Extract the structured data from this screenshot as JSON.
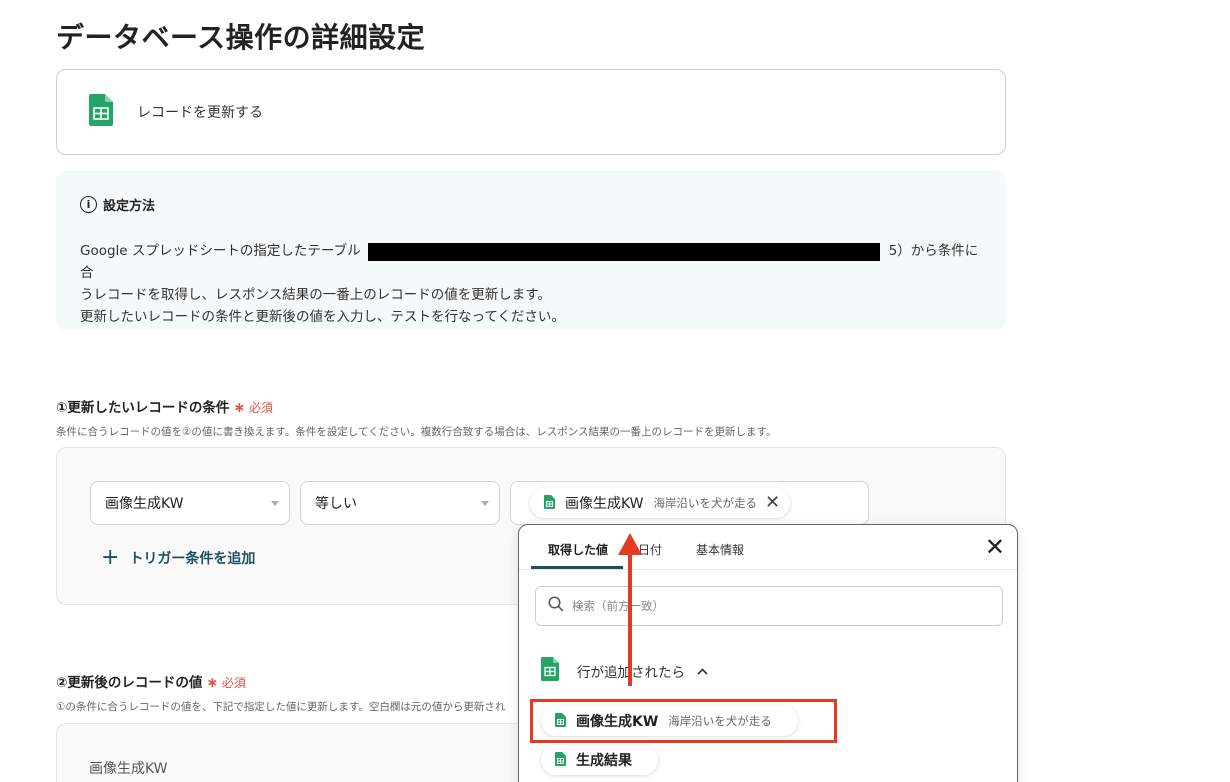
{
  "page": {
    "title": "データベース操作の詳細設定"
  },
  "action": {
    "label": "レコードを更新する",
    "icon": "google-sheets-icon"
  },
  "help": {
    "title": "設定方法",
    "line1_start": "Google スプレッドシートの指定したテーブル（1",
    "line1_end": "5）から条件に合",
    "line2": "うレコードを取得し、レスポンス結果の一番上のレコードの値を更新します。",
    "line3": "更新したいレコードの条件と更新後の値を入力し、テストを行なってください。"
  },
  "section1": {
    "title": "①更新したいレコードの条件",
    "required": "必須",
    "required_mark": "∗",
    "description": "条件に合うレコードの値を②の値に書き換えます。条件を設定してください。複数行合致する場合は、レスポンス結果の一番上のレコードを更新します。",
    "field_select": "画像生成KW",
    "operator_select": "等しい",
    "value_chip": {
      "label": "画像生成KW",
      "value": "海岸沿いを犬が走る"
    },
    "add_trigger": "トリガー条件を追加"
  },
  "section2": {
    "title": "②更新後のレコードの値",
    "required": "必須",
    "required_mark": "∗",
    "description": "①の条件に合うレコードの値を、下記で指定した値に更新します。空白欄は元の値から更新され",
    "field_label": "画像生成KW"
  },
  "panel": {
    "tabs": [
      "取得した値",
      "日付",
      "基本情報"
    ],
    "active_tab": "取得した値",
    "search_placeholder": "検索（前方一致）",
    "group": {
      "label": "行が追加されたら"
    },
    "items": [
      {
        "label": "画像生成KW",
        "value": "海岸沿いを犬が走る"
      },
      {
        "label": "生成結果",
        "value": ""
      }
    ]
  },
  "colors": {
    "accent": "#1f4f5f",
    "required": "#e05248",
    "highlight": "#e23b22",
    "sheets_green": "#23a566"
  }
}
